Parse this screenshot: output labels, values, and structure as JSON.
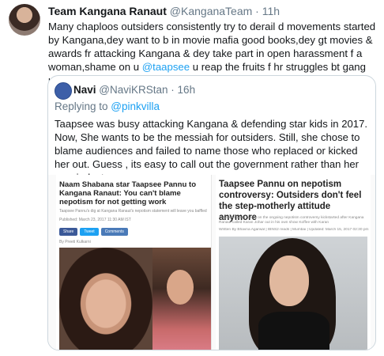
{
  "tweet": {
    "display_name": "Team Kangana Ranaut",
    "handle": "@KanganaTeam",
    "separator": " · ",
    "time": "11h",
    "text_before_mention": "Many chaploos outsiders consistently try to derail d movements started by Kangana,dey want to b in movie mafia good books,dey gt movies & awards fr attacking Kangana & dey take part in open harassment f a woman,shame on u ",
    "mention": "@taapsee",
    "text_after_mention": " u reap the fruits f hr struggles bt gang up on hr"
  },
  "quote": {
    "display_name": "Navi",
    "handle": "@NaviKRStan",
    "separator": " · ",
    "time": "16h",
    "replying_prefix": "Replying to ",
    "replying_to": "@pinkvilla",
    "text": "Taapsee was busy attacking Kangana & defending star kids in 2017. Now, She wants to be the messiah for outsiders. Still, she chose to blame audiences and failed to name those who replaced or kicked her out. Guess , its easy to call out the government rather than her own industry"
  },
  "articles": {
    "left": {
      "headline": "Naam Shabana star Taapsee Pannu to Kangana Ranaut: You can't blame nepotism for not getting work",
      "sub": "Taapsee Pannu's dig at Kangana Ranaut's nepotism statement will leave you baffled",
      "date": "Published: March 23, 2017 11:30 AM IST",
      "share_facebook": "Share",
      "share_twitter": "Tweet",
      "share_comments": "Comments",
      "byline": "By Preeti Kulkarni"
    },
    "right": {
      "headline": "Taapsee Pannu on nepotism controversy: Outsiders don't feel the step-motherly attitude anymore",
      "sub": "Taapsee Pannu reacts on the ongoing nepotism controversy kickstarted after Kangana Ranaut called Karan Johar out in his own show Koffee with Karan",
      "meta": "Written By Bhavna Agarwal | IBNS2 reads | Mumbai | Updated: March 15, 2017 02:30 pm"
    }
  },
  "colors": {
    "link": "#1da1f2",
    "muted": "#657786",
    "border": "#ccd6dd"
  }
}
